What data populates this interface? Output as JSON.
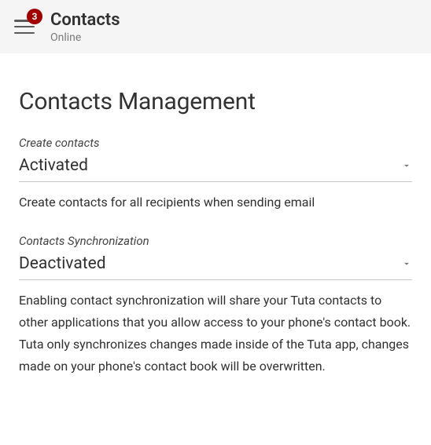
{
  "header": {
    "badge_count": "3",
    "title": "Contacts",
    "subtitle": "Online"
  },
  "page": {
    "title": "Contacts Management"
  },
  "settings": {
    "create_contacts": {
      "label": "Create contacts",
      "value": "Activated",
      "description": "Create contacts for all recipients when sending email"
    },
    "sync": {
      "label": "Contacts Synchronization",
      "value": "Deactivated",
      "description": "Enabling contact synchronization will share your Tuta contacts to other applications that you allow access to your phone's contact book. Tuta only synchronizes changes made inside of the Tuta app, changes made on your phone's contact book will be overwritten."
    }
  }
}
